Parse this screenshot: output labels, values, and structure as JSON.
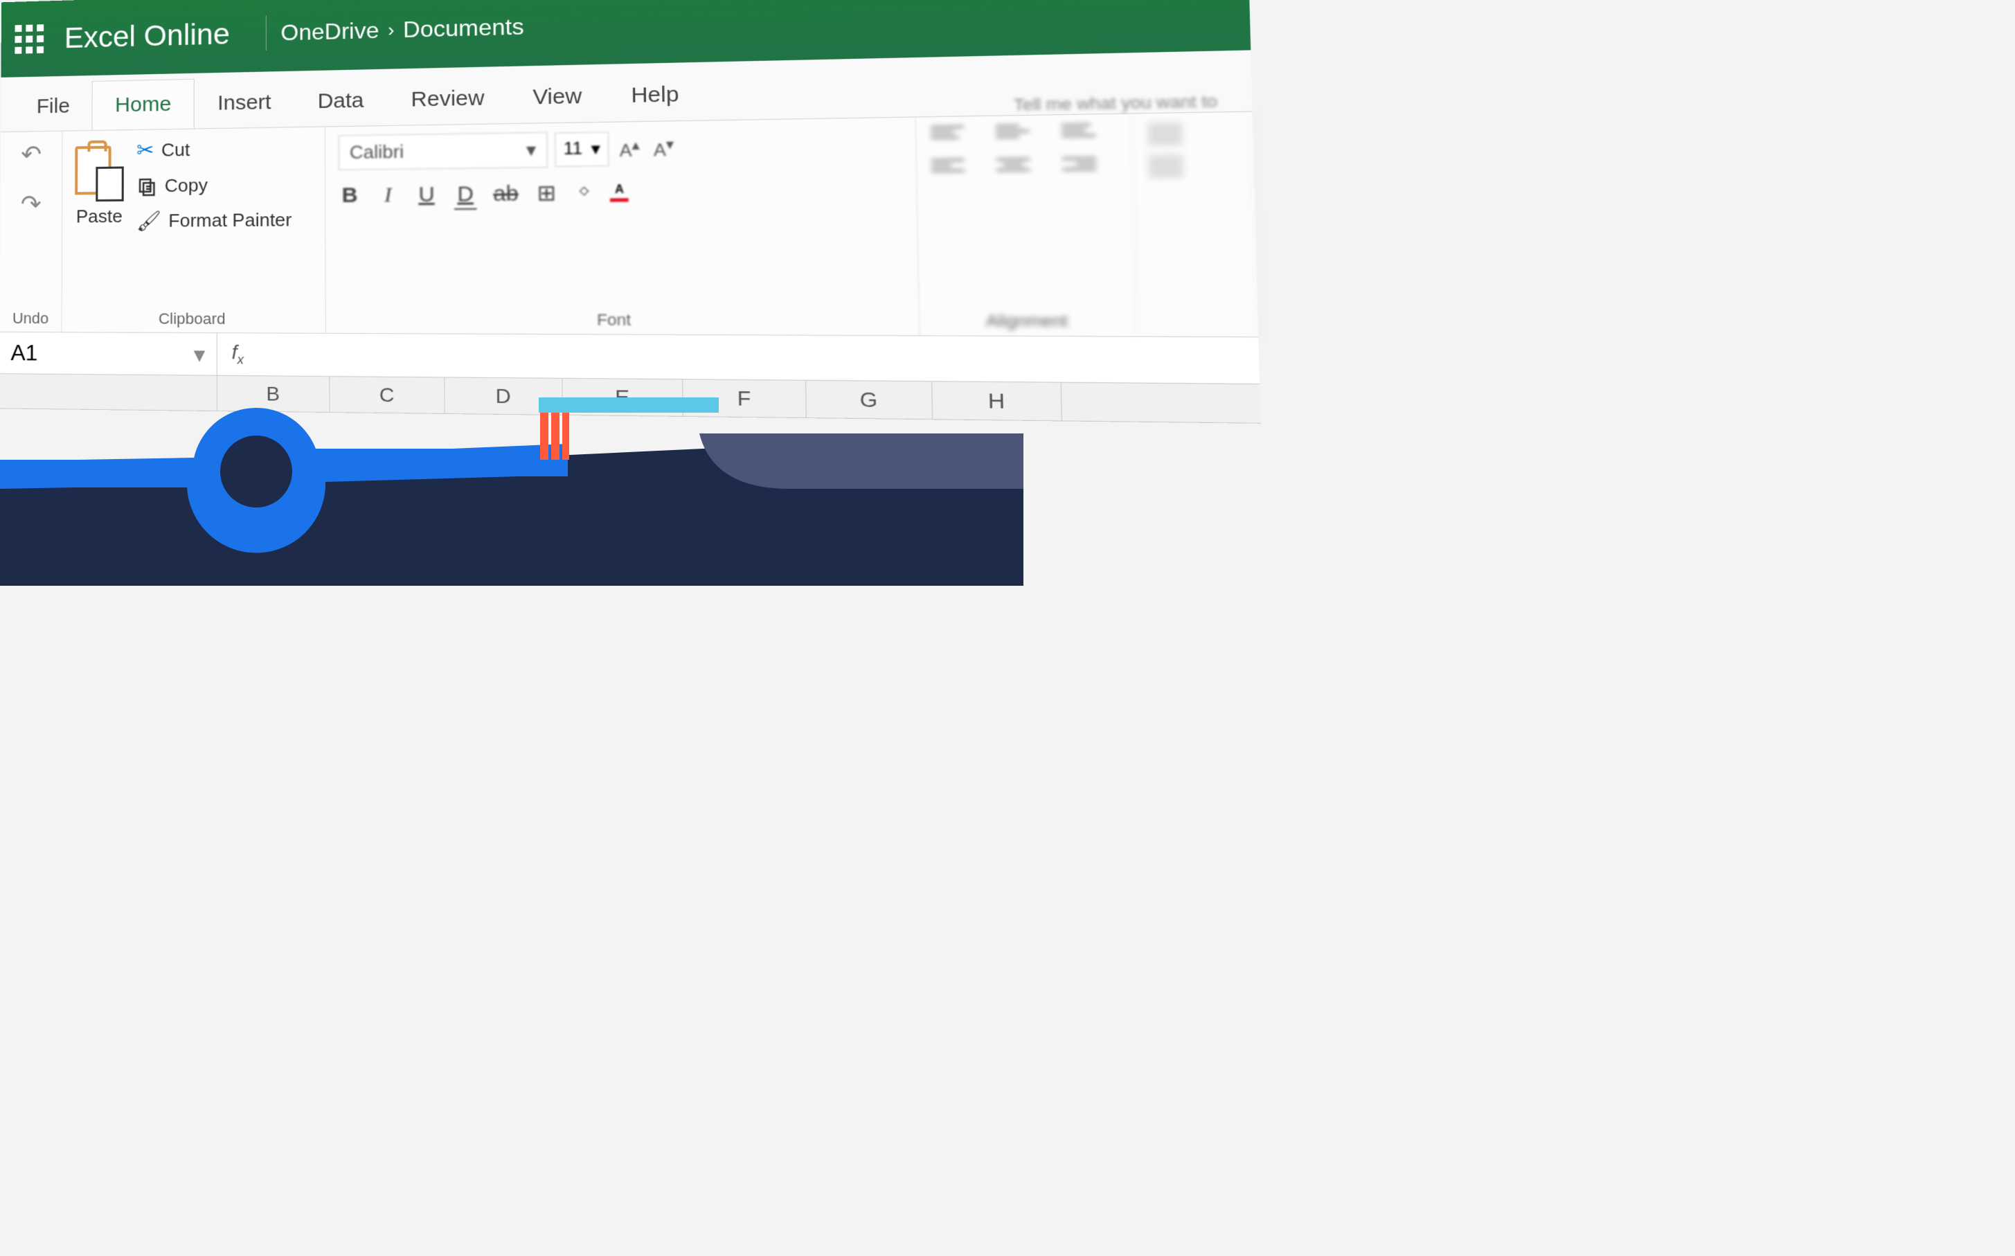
{
  "header": {
    "app_title": "Excel Online",
    "breadcrumb": {
      "root": "OneDrive",
      "current": "Documents"
    }
  },
  "tabs": {
    "file": "File",
    "home": "Home",
    "insert": "Insert",
    "data": "Data",
    "review": "Review",
    "view": "View",
    "help": "Help",
    "tellme_placeholder": "Tell me what you want to"
  },
  "ribbon": {
    "undo_group_label": "Undo",
    "clipboard": {
      "paste": "Paste",
      "cut": "Cut",
      "copy": "Copy",
      "format_painter": "Format Painter",
      "group_label": "Clipboard"
    },
    "font": {
      "name": "Calibri",
      "size": "11",
      "bold": "B",
      "italic": "I",
      "underline": "U",
      "double_underline": "D",
      "strikethrough": "ab",
      "group_label": "Font",
      "fill_color": "#ffd800",
      "font_color": "#e81123"
    },
    "alignment": {
      "group_label": "Alignment"
    }
  },
  "formula_bar": {
    "cell_ref": "A1",
    "fx": "f",
    "fx_sub": "x"
  },
  "columns": [
    "B",
    "C",
    "D",
    "E",
    "F",
    "G",
    "H"
  ],
  "colors": {
    "brand_green": "#217346",
    "overlay_navy": "#1e2a4a",
    "overlay_blue": "#1a73e8",
    "overlay_cyan": "#5bc8e8",
    "overlay_orange": "#ff5a3c",
    "overlay_slate": "#4a5578"
  }
}
